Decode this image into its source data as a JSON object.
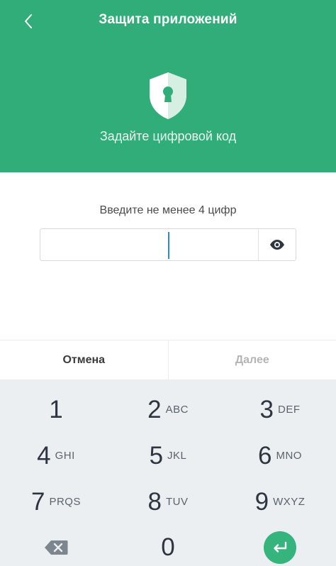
{
  "header": {
    "title": "Защита приложений",
    "subtitle": "Задайте цифровой код",
    "back_icon": "chevron-left-icon",
    "shield_icon": "shield-keyhole-icon",
    "color": "#30ad78"
  },
  "pin": {
    "prompt": "Введите не менее 4 цифр",
    "value": "",
    "toggle_icon": "eye-icon"
  },
  "actions": {
    "cancel": "Отмена",
    "next": "Далее"
  },
  "keypad": {
    "keys": [
      {
        "digit": "1",
        "letters": ""
      },
      {
        "digit": "2",
        "letters": "ABC"
      },
      {
        "digit": "3",
        "letters": "DEF"
      },
      {
        "digit": "4",
        "letters": "GHI"
      },
      {
        "digit": "5",
        "letters": "JKL"
      },
      {
        "digit": "6",
        "letters": "MNO"
      },
      {
        "digit": "7",
        "letters": "PRQS"
      },
      {
        "digit": "8",
        "letters": "TUV"
      },
      {
        "digit": "9",
        "letters": "WXYZ"
      },
      {
        "digit": "0",
        "letters": ""
      }
    ],
    "backspace_icon": "backspace-icon",
    "enter_icon": "enter-icon"
  }
}
